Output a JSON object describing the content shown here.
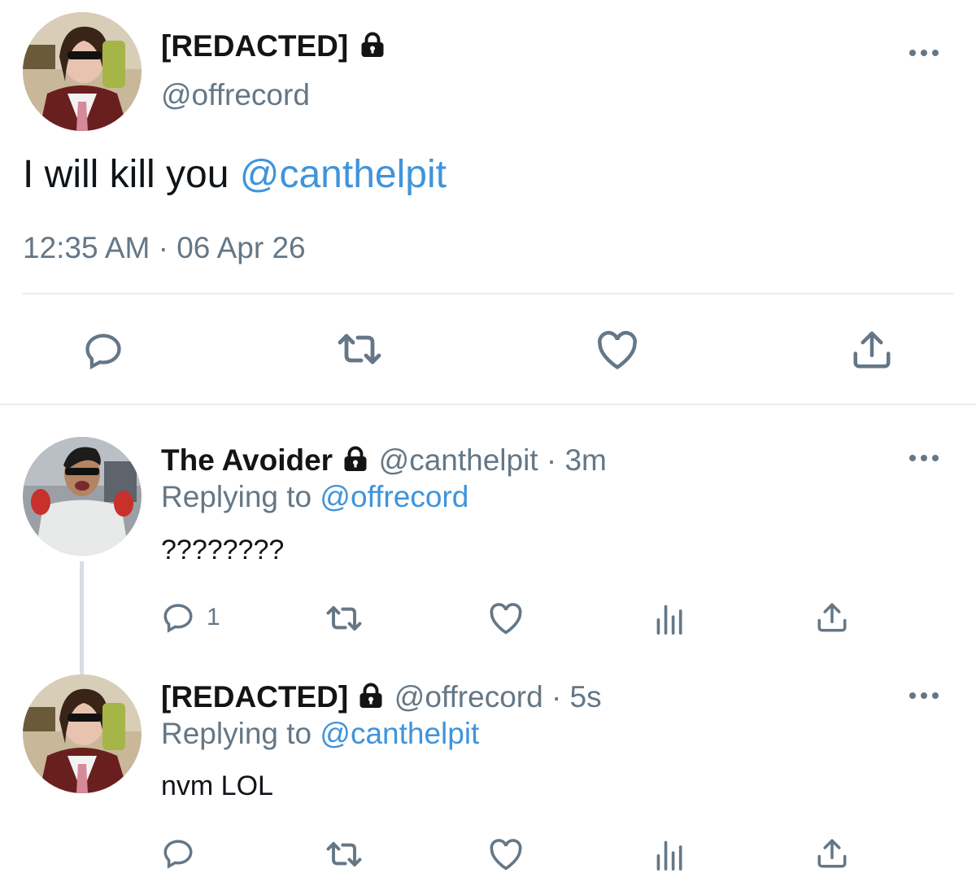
{
  "main_tweet": {
    "display_name": "[REDACTED]",
    "handle": "@offrecord",
    "text_plain": "I will kill you",
    "mention": "@canthelpit",
    "timestamp": "12:35 AM · 06 Apr 26"
  },
  "reply1": {
    "display_name": "The Avoider",
    "handle_time": "@canthelpit · 3m",
    "replying_prefix": "Replying to",
    "replying_handle": "@offrecord",
    "text": "????????",
    "reply_count": "1"
  },
  "reply2": {
    "display_name": "[REDACTED]",
    "handle_time": "@offrecord · 5s",
    "replying_prefix": "Replying to",
    "replying_handle": "@canthelpit",
    "text": "nvm LOL"
  },
  "colors": {
    "link": "#3f94db",
    "secondary": "#657786",
    "divider": "#e6ecf0"
  },
  "icons": [
    "lock-icon",
    "more-icon",
    "reply-icon",
    "retweet-icon",
    "like-icon",
    "share-icon",
    "analytics-icon"
  ]
}
